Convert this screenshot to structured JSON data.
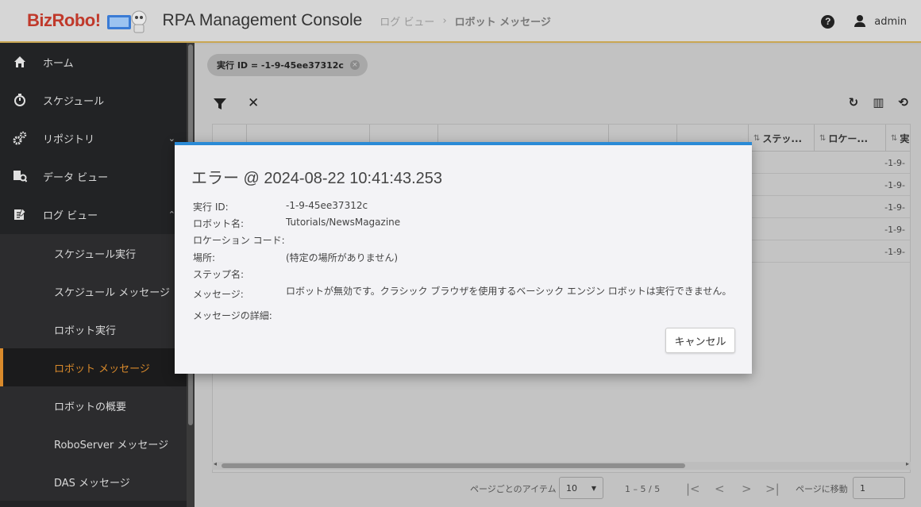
{
  "header": {
    "logo_text": "BizRobo!",
    "app_title": "RPA Management Console",
    "breadcrumb_parent": "ログ ビュー",
    "breadcrumb_separator": "›",
    "breadcrumb_current": "ロボット メッセージ",
    "help_icon": "?",
    "username": "admin"
  },
  "sidebar": {
    "items": [
      {
        "label": "ホーム",
        "icon": "home-icon"
      },
      {
        "label": "スケジュール",
        "icon": "timer-icon"
      },
      {
        "label": "リポジトリ",
        "icon": "gears-icon",
        "chevron": "⌄"
      },
      {
        "label": "データ ビュー",
        "icon": "data-view-icon"
      },
      {
        "label": "ログ ビュー",
        "icon": "log-icon",
        "chevron": "⌃"
      }
    ],
    "subitems": [
      {
        "label": "スケジュール実行"
      },
      {
        "label": "スケジュール メッセージ"
      },
      {
        "label": "ロボット実行"
      },
      {
        "label": "ロボット メッセージ",
        "active": true
      },
      {
        "label": "ロボットの概要"
      },
      {
        "label": "RoboServer メッセージ"
      },
      {
        "label": "DAS メッセージ"
      }
    ]
  },
  "filter_chip": {
    "label": "実行 ID = -1-9-45ee37312c",
    "close": "×"
  },
  "toolbar": {
    "clear": "✕",
    "refresh": "↻",
    "columns": "▥",
    "history": "⟲"
  },
  "grid": {
    "headers": [
      "ステッ...",
      "ロケー...",
      "実"
    ],
    "sort_glyph": "⇅",
    "rows": [
      "-1-9-",
      "-1-9-",
      "-1-9-",
      "-1-9-",
      "-1-9-"
    ]
  },
  "pager": {
    "items_per_page_label": "ページごとのアイテム",
    "items_per_page_value": "10",
    "range": "1 – 5 / 5",
    "first": "|<",
    "prev": "<",
    "next": ">",
    "last": ">|",
    "goto_label": "ページに移動",
    "goto_value": "1"
  },
  "dialog": {
    "title": "エラー @ 2024-08-22 10:41:43.253",
    "fields": [
      {
        "key": "実行 ID:",
        "value": "-1-9-45ee37312c"
      },
      {
        "key": "ロボット名:",
        "value": "Tutorials/NewsMagazine"
      },
      {
        "key": "ロケーション コード:",
        "value": ""
      },
      {
        "key": "場所:",
        "value": "(特定の場所がありません)"
      },
      {
        "key": "ステップ名:",
        "value": ""
      },
      {
        "key": "メッセージ:",
        "value": "ロボットが無効です。クラシック ブラウザを使用するベーシック エンジン ロボットは実行できません。"
      },
      {
        "key": "メッセージの詳細:",
        "value": ""
      }
    ],
    "cancel_label": "キャンセル",
    "accent_color": "#2a8ad6"
  }
}
